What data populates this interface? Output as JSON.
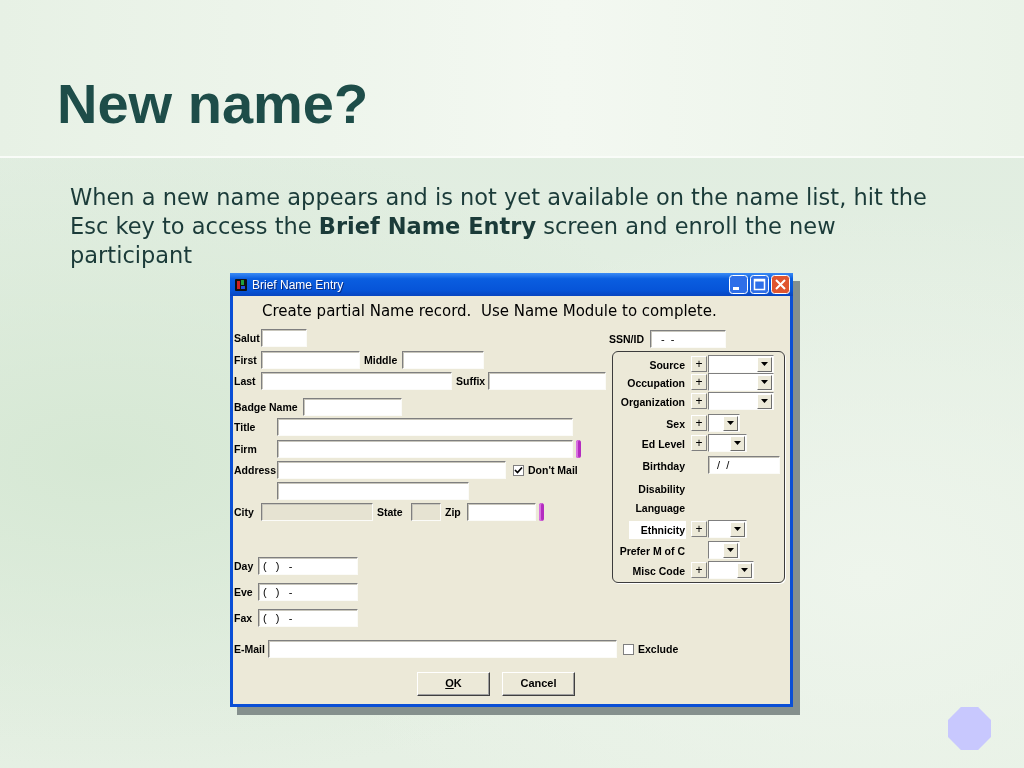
{
  "slide": {
    "title": "New name?",
    "body": "When a new name appears and is not yet available on the name list, hit the Esc key to access the **Brief Name Entry** screen and enroll the new participant"
  },
  "dialog": {
    "title": "Brief Name Entry",
    "heading": "Create partial Name record.  Use Name Module to complete.",
    "rows": [
      {
        "items": [
          {
            "kind": "field",
            "label": "Salut",
            "disabled": false,
            "flagged": false
          }
        ]
      },
      {
        "items": [
          {
            "kind": "field",
            "label": "First",
            "disabled": false,
            "flagged": false
          },
          {
            "kind": "field",
            "label": "Middle",
            "disabled": false,
            "flagged": false
          }
        ]
      },
      {
        "items": [
          {
            "kind": "field",
            "label": "Last",
            "disabled": false,
            "flagged": false
          },
          {
            "kind": "field",
            "label": "Suffix",
            "disabled": false,
            "flagged": false
          }
        ]
      },
      {
        "items": [
          {
            "kind": "field",
            "label": "Badge Name",
            "disabled": false,
            "flagged": false
          }
        ]
      },
      {
        "items": [
          {
            "kind": "field",
            "label": "Title",
            "disabled": false,
            "flagged": false
          }
        ]
      },
      {
        "items": [
          {
            "kind": "field",
            "label": "Firm",
            "disabled": false,
            "flagged": true
          }
        ]
      },
      {
        "items": [
          {
            "kind": "field",
            "label": "Address",
            "disabled": false,
            "flagged": false
          },
          {
            "kind": "checkbox",
            "label": "Don't Mail",
            "checked": true
          }
        ]
      },
      {
        "items": [
          {
            "kind": "field",
            "disabled": false,
            "flagged": false
          }
        ]
      },
      {
        "items": [
          {
            "kind": "field",
            "label": "City",
            "disabled": true,
            "flagged": false
          },
          {
            "kind": "field",
            "label": "State",
            "disabled": true,
            "flagged": false
          },
          {
            "kind": "field",
            "label": "Zip",
            "disabled": false,
            "flagged": true
          }
        ]
      },
      {
        "items": [
          {
            "kind": "field",
            "label": "Day",
            "value": "(   )   -",
            "disabled": false,
            "flagged": false
          }
        ]
      },
      {
        "items": [
          {
            "kind": "field",
            "label": "Eve",
            "value": "(   )   -",
            "disabled": false,
            "flagged": false
          }
        ]
      },
      {
        "items": [
          {
            "kind": "field",
            "label": "Fax",
            "value": "(   )   -",
            "disabled": false,
            "flagged": false
          }
        ]
      },
      {
        "items": [
          {
            "kind": "field",
            "label": "E-Mail",
            "disabled": false,
            "flagged": false
          },
          {
            "kind": "checkbox",
            "label": "Exclude",
            "checked": false
          }
        ]
      }
    ],
    "ssn": {
      "label": "SSN/ID",
      "value": "-  -"
    },
    "group": [
      {
        "label": "Source",
        "kind": "dropdown",
        "add_label": "+",
        "highlighted": false
      },
      {
        "label": "Occupation",
        "kind": "dropdown",
        "add_label": "+",
        "highlighted": false
      },
      {
        "label": "Organization",
        "kind": "dropdown",
        "add_label": "+",
        "highlighted": false
      },
      {
        "label": "Sex",
        "kind": "dropdown",
        "add_label": "+",
        "highlighted": false
      },
      {
        "label": "Ed Level",
        "kind": "dropdown",
        "add_label": "+",
        "highlighted": false
      },
      {
        "label": "Birthday",
        "kind": "field",
        "value": "/  /",
        "highlighted": false
      },
      {
        "label": "Disability",
        "kind": "label",
        "highlighted": false
      },
      {
        "label": "Language",
        "kind": "label",
        "highlighted": false
      },
      {
        "label": "Ethnicity",
        "kind": "dropdown",
        "add_label": "+",
        "highlighted": true
      },
      {
        "label": "Prefer M of C",
        "kind": "dropdown",
        "highlighted": false
      },
      {
        "label": "Misc Code",
        "kind": "dropdown",
        "add_label": "+",
        "highlighted": false
      }
    ],
    "buttons": [
      {
        "label": "OK",
        "mnemonic": true
      },
      {
        "label": "Cancel",
        "mnemonic": false
      }
    ]
  }
}
